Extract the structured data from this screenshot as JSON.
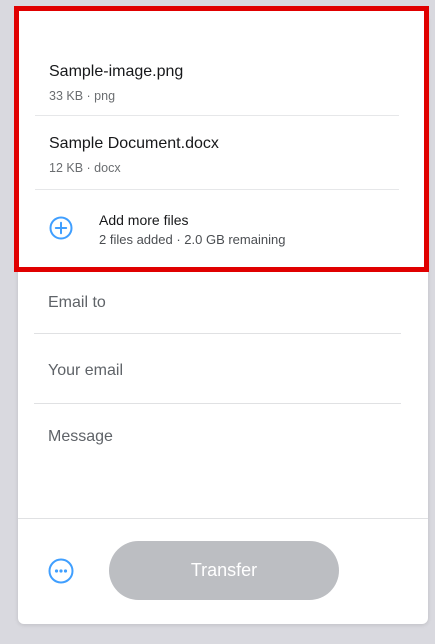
{
  "files": [
    {
      "name": "Sample-image.png",
      "meta": "33 KB · png"
    },
    {
      "name": "Sample Document.docx",
      "meta": "12 KB · docx"
    }
  ],
  "add_files": {
    "label": "Add more files",
    "status": "2 files added · 2.0 GB remaining",
    "icon": "plus-circle-icon"
  },
  "form": {
    "email_to_placeholder": "Email to",
    "your_email_placeholder": "Your email",
    "message_placeholder": "Message"
  },
  "footer": {
    "options_icon": "more-options-icon",
    "transfer_label": "Transfer"
  },
  "colors": {
    "accent": "#409fff",
    "highlight_border": "#e00000",
    "button_disabled": "#bcbec2"
  }
}
